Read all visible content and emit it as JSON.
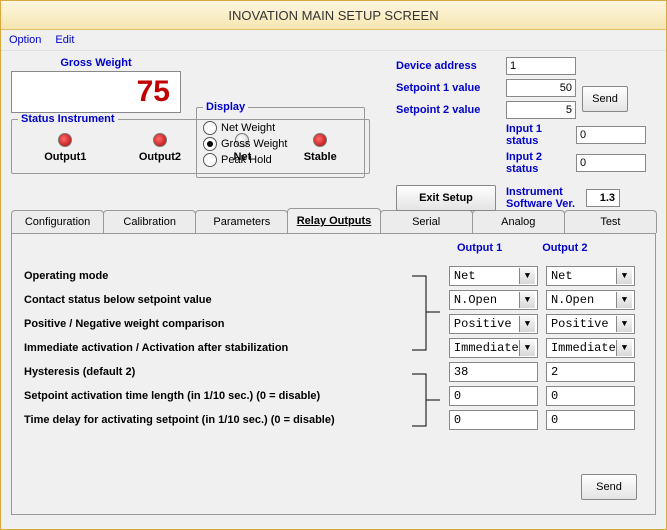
{
  "title": "INOVATION MAIN SETUP SCREEN",
  "menu": {
    "option": "Option",
    "edit": "Edit"
  },
  "gross_weight": {
    "label": "Gross Weight",
    "value": "75"
  },
  "display_group": {
    "legend": "Display",
    "net": "Net Weight",
    "gross": "Gross Weight",
    "peak": "Peak Hold"
  },
  "rhs": {
    "device_address": {
      "label": "Device address",
      "value": "1"
    },
    "sp1": {
      "label": "Setpoint 1 value",
      "value": "50"
    },
    "sp2": {
      "label": "Setpoint 2 value",
      "value": "5"
    },
    "in1": {
      "label": "Input 1 status",
      "value": "0"
    },
    "in2": {
      "label": "Input 2 status",
      "value": "0"
    },
    "send": "Send"
  },
  "status": {
    "legend": "Status Instrument",
    "out1": "Output1",
    "out2": "Output2",
    "net": "Net",
    "stable": "Stable"
  },
  "exit": {
    "btn": "Exit Setup",
    "sw_label": "Instrument Software Ver.",
    "sw_ver": "1.3"
  },
  "tabs": {
    "config": "Configuration",
    "calib": "Calibration",
    "params": "Parameters",
    "relay": "Relay Outputs",
    "serial": "Serial",
    "analog": "Analog",
    "test": "Test"
  },
  "relay": {
    "hdr1": "Output 1",
    "hdr2": "Output 2",
    "rows": {
      "mode": {
        "label": "Operating mode",
        "o1": "Net",
        "o2": "Net"
      },
      "contact": {
        "label": "Contact status below setpoint value",
        "o1": "N.Open",
        "o2": "N.Open"
      },
      "posneg": {
        "label": "Positive / Negative weight comparison",
        "o1": "Positive",
        "o2": "Positive"
      },
      "immed": {
        "label": "Immediate activation / Activation after stabilization",
        "o1": "Immediate",
        "o2": "Immediate"
      },
      "hyst": {
        "label": "Hysteresis (default 2)",
        "o1": "38",
        "o2": "2"
      },
      "actlen": {
        "label": "Setpoint activation time length (in 1/10 sec.) (0 = disable)",
        "o1": "0",
        "o2": "0"
      },
      "delay": {
        "label": "Time delay for activating setpoint (in 1/10 sec.) (0 = disable)",
        "o1": "0",
        "o2": "0"
      }
    },
    "send": "Send"
  }
}
